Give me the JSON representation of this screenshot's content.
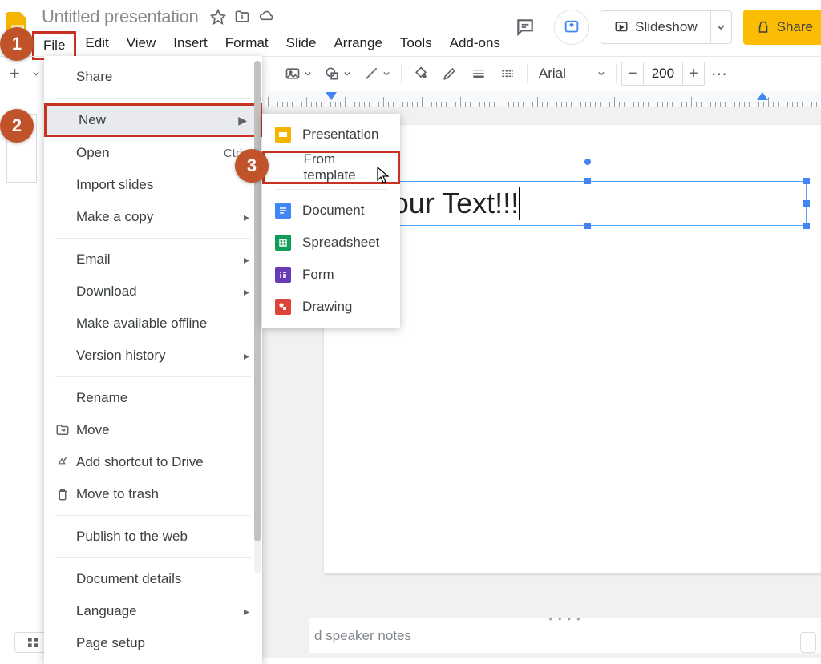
{
  "header": {
    "doc_title": "Untitled presentation",
    "slideshow_label": "Slideshow",
    "share_label": "Share"
  },
  "menubar": [
    "File",
    "Edit",
    "View",
    "Insert",
    "Format",
    "Slide",
    "Arrange",
    "Tools",
    "Add-ons"
  ],
  "toolbar": {
    "font_name": "Arial",
    "font_size": "200"
  },
  "file_menu": {
    "share": "Share",
    "new": "New",
    "open": "Open",
    "open_hotkey": "Ctrl+",
    "import_slides": "Import slides",
    "make_copy": "Make a copy",
    "email": "Email",
    "download": "Download",
    "offline": "Make available offline",
    "version_history": "Version history",
    "rename": "Rename",
    "move": "Move",
    "add_shortcut": "Add shortcut to Drive",
    "trash": "Move to trash",
    "publish": "Publish to the web",
    "doc_details": "Document details",
    "language": "Language",
    "page_setup": "Page setup"
  },
  "new_submenu": {
    "presentation": "Presentation",
    "from_template": "From template",
    "document": "Document",
    "spreadsheet": "Spreadsheet",
    "form": "Form",
    "drawing": "Drawing"
  },
  "slide": {
    "text_content": "Your Text!!!"
  },
  "speaker_notes_placeholder": "d speaker notes",
  "badges": {
    "b1": "1",
    "b2": "2",
    "b3": "3"
  },
  "colors": {
    "slides_yellow": "#f4b400",
    "outline_red": "#c63324",
    "docs_blue": "#4285f4",
    "sheets_green": "#0f9d58",
    "forms_purple": "#673ab7",
    "drawings_red": "#db4437"
  }
}
